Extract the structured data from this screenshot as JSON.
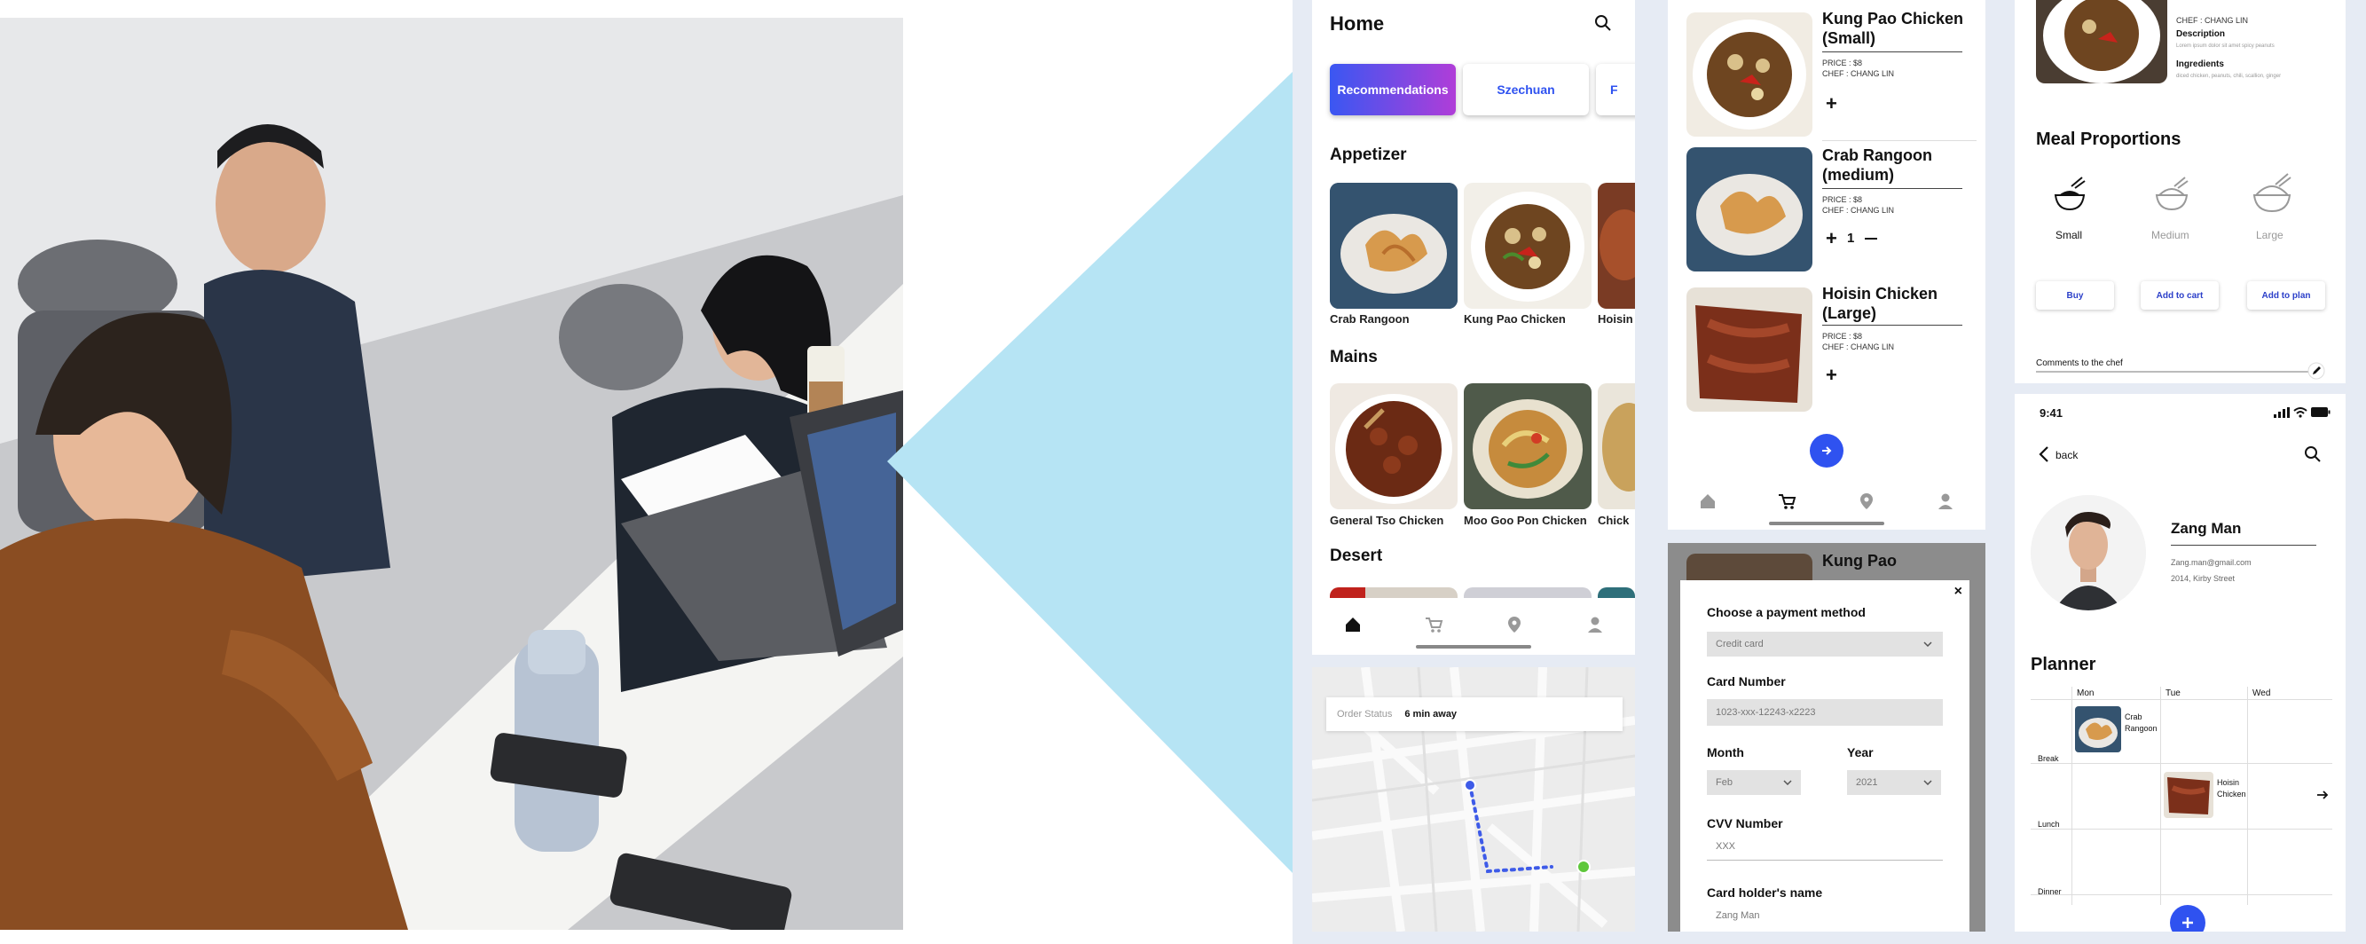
{
  "home": {
    "title": "Home",
    "tabs": [
      "Recommendations",
      "Szechuan",
      "F"
    ],
    "sections": {
      "appetizer": "Appetizer",
      "mains": "Mains",
      "desert": "Desert"
    },
    "appetizers": [
      "Crab Rangoon",
      "Kung Pao Chicken",
      "Hoisin"
    ],
    "mains": [
      "General Tso Chicken",
      "Moo Goo Pon Chicken",
      "Chick"
    ]
  },
  "order_status": {
    "label": "Order Status",
    "value": "6 min away"
  },
  "cart": {
    "items": [
      {
        "name": "Kung Pao Chicken (Small)",
        "price": "PRICE : $8",
        "chef": "CHEF : CHANG LIN"
      },
      {
        "name": "Crab Rangoon (medium)",
        "price": "PRICE : $8",
        "chef": "CHEF : CHANG LIN",
        "qty": "1"
      },
      {
        "name": "Hoisin Chicken (Large)",
        "price": "PRICE : $8",
        "chef": "CHEF : CHANG LIN"
      }
    ]
  },
  "payment": {
    "bg_title": "Kung Pao",
    "title": "Choose a payment method",
    "method": "Credit card",
    "card_number_label": "Card Number",
    "card_number": "1023-xxx-12243-x2223",
    "month_label": "Month",
    "month": "Feb",
    "year_label": "Year",
    "year": "2021",
    "cvv_label": "CVV Number",
    "cvv": "XXX",
    "holder_label": "Card holder's name",
    "holder": "Zang Man"
  },
  "detail": {
    "chef": "CHEF : CHANG LIN",
    "description_label": "Description",
    "description": "Lorem ipsum dolor sit amet spicy peanuts",
    "ingredients_label": "Ingredients",
    "ingredients": "diced chicken, peanuts, chili, scallion, ginger",
    "proportions_title": "Meal Proportions",
    "sizes": [
      "Small",
      "Medium",
      "Large"
    ],
    "buttons": [
      "Buy",
      "Add to cart",
      "Add to plan"
    ],
    "comments_label": "Comments to the chef"
  },
  "profile": {
    "time": "9:41",
    "back": "back",
    "name": "Zang Man",
    "email": "Zang.man@gmail.com",
    "address": "2014, Kirby Street",
    "planner_title": "Planner",
    "days": [
      "Mon",
      "Tue",
      "Wed"
    ],
    "meals": [
      "Break",
      "Lunch",
      "Dinner"
    ],
    "planned": [
      "Crab Rangoon",
      "Hoisin Chicken"
    ]
  },
  "colors": {
    "accent_blue": "#2f52f0",
    "gradient_start": "#3a57f2",
    "gradient_end": "#b03dd8",
    "beam": "#b6e4f4",
    "route": "#3e5be8",
    "destination": "#5ec73b"
  }
}
